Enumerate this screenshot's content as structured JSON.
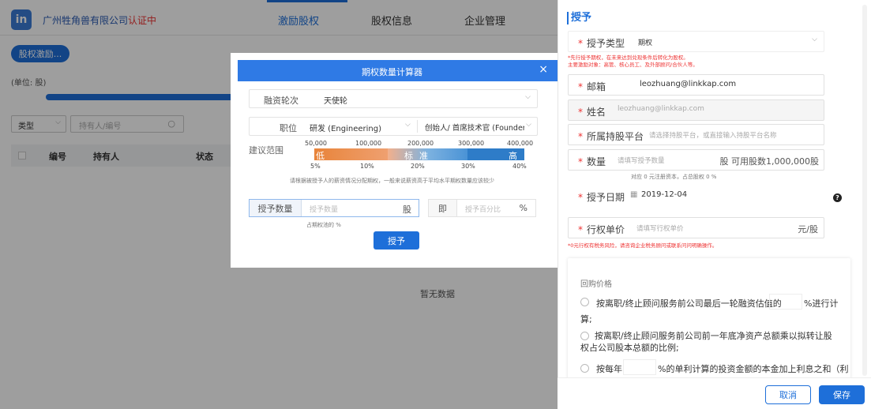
{
  "header": {
    "company": "广州牲角兽有限公司",
    "status": "认证中",
    "tabs": [
      "激励股权",
      "股权信息",
      "企业管理"
    ]
  },
  "main": {
    "action_button": "股权激励...",
    "unit": "(单位: 股)",
    "filter_type": "类型",
    "search_placeholder": "持有人/编号",
    "columns": [
      "编号",
      "持有人",
      "状态"
    ],
    "empty": "暂无数据"
  },
  "calc": {
    "title": "期权数量计算器",
    "round_label": "融资轮次",
    "round_value": "天使轮",
    "position_label": "职位",
    "dept_value": "研发 (Engineering)",
    "role_value": "创始人/ 首席技术官 (Founder,",
    "range_label": "建议范围",
    "ticks_top": [
      "50,000",
      "100,000",
      "200,000",
      "300,000",
      "400,000"
    ],
    "ticks_bottom": [
      "5%",
      "10%",
      "20%",
      "30%",
      "40%"
    ],
    "seg_labels": [
      "低",
      "标",
      "准",
      "高"
    ],
    "hint": "请根据被授予人的薪资情况分配期权，一般来说薪资高于平均水平期权数量应该较少",
    "qty_label": "授予数量",
    "qty_placeholder": "授予数量",
    "qty_unit": "股",
    "ratio_label": "即",
    "ratio_placeholder": "授予百分比",
    "ratio_unit": "%",
    "share_note": "占期权池的 %",
    "grant_button": "授予",
    "close": "×"
  },
  "panel": {
    "title": "授予",
    "type_label": "授予类型",
    "type_value": "期权",
    "notice": [
      "*先行授予期权，在未来达到兑现条件后转化为股权。",
      "主要激励对象：高管、核心员工、及外部顾问/合伙人等。"
    ],
    "email_label": "邮箱",
    "email_value": "leozhuang@linkkap.com",
    "name_label": "姓名",
    "name_value": "leozhuang@linkkap.com",
    "platform_label": "所属持股平台",
    "platform_placeholder": "请选择持股平台，或直接输入持股平台名称",
    "qty_label": "数量",
    "qty_placeholder": "请填写授予数量",
    "qty_suffix": "股 可用股数1,000,000股",
    "qty_note": "对应 0 元注册资本，占总股权 0 %",
    "date_label": "授予日期",
    "date_value": "2019-12-04",
    "help": "?",
    "price_label": "行权单价",
    "price_placeholder": "请填写行权单价",
    "price_unit": "元/股",
    "tax_note": "*0元行权有税务风险，请咨询企业税务顾问或联系问问明确操作。",
    "buyback": {
      "title": "回购价格",
      "opt1a": "按离职/终止顾问服务前公司最后一轮融资估值的",
      "opt1b": "%进行计",
      "opt1c": "算;",
      "opt2": "按离职/终止顾问服务前公司前一年底净资产总额乘以拟转让股权占公司股本总额的比例;",
      "opt3a": "按每年",
      "opt3b": "%的单利计算的投资金额的本金加上利息之和（利"
    },
    "cancel": "取消",
    "save": "保存"
  }
}
